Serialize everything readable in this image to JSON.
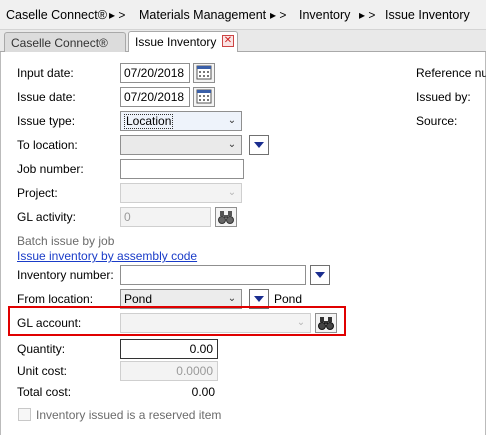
{
  "breadcrumb": {
    "items": [
      "Caselle Connect®",
      "Materials Management",
      "Inventory",
      "Issue Inventory"
    ],
    "sep_first": "▸ >",
    "sep": ">"
  },
  "tabs": {
    "inactive_label": "Caselle Connect®",
    "active_label": "Issue Inventory",
    "close_glyph": "✕"
  },
  "form": {
    "input_date": {
      "label": "Input date:",
      "value": "07/20/2018"
    },
    "issue_date": {
      "label": "Issue date:",
      "value": "07/20/2018"
    },
    "issue_type": {
      "label": "Issue type:",
      "value": "Location"
    },
    "to_location": {
      "label": "To location:",
      "value": ""
    },
    "job_number": {
      "label": "Job number:",
      "value": ""
    },
    "project": {
      "label": "Project:",
      "value": ""
    },
    "gl_activity": {
      "label": "GL activity:",
      "value": "0"
    },
    "batch_issue_label": "Batch issue by job",
    "assembly_link": "Issue inventory by assembly code",
    "inventory_number": {
      "label": "Inventory number:",
      "value": ""
    },
    "from_location": {
      "label": "From location:",
      "value": "Pond",
      "desc": "Pond"
    },
    "gl_account": {
      "label": "GL account:",
      "value": ""
    },
    "quantity": {
      "label": "Quantity:",
      "value": "0.00"
    },
    "unit_cost": {
      "label": "Unit cost:",
      "value": "0.0000"
    },
    "total_cost": {
      "label": "Total cost:",
      "value": "0.00"
    },
    "reserved": {
      "label": "Inventory issued is a reserved item",
      "checked": false
    }
  },
  "right_panel": {
    "reference_label": "Reference nur",
    "issued_by_label": "Issued by:",
    "source_label": "Source:"
  },
  "icons": {
    "calendar": "calendar-icon",
    "binoculars": "binoculars-icon",
    "dropdown": "dropdown-arrow-icon"
  },
  "colors": {
    "highlight": "#e00000",
    "link": "#1a3cc8",
    "dropdown_arrow": "#1a2d8f"
  }
}
